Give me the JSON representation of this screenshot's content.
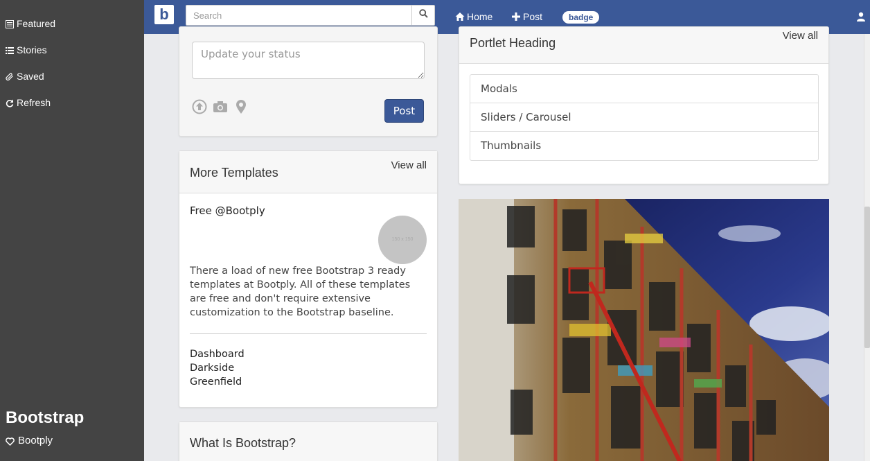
{
  "sidebar": {
    "items": [
      {
        "label": "Featured",
        "icon": "list-alt-icon"
      },
      {
        "label": "Stories",
        "icon": "list-icon"
      },
      {
        "label": "Saved",
        "icon": "paperclip-icon"
      },
      {
        "label": "Refresh",
        "icon": "refresh-icon"
      }
    ],
    "brand_title": "Bootstrap",
    "brand_sub": "Bootply"
  },
  "navbar": {
    "logo": "b",
    "search_placeholder": "Search",
    "home_label": "Home",
    "post_label": "Post",
    "badge_label": "badge",
    "colors": {
      "brand": "#3b5998"
    }
  },
  "status": {
    "placeholder": "Update your status",
    "post_button": "Post"
  },
  "templates": {
    "title": "More Templates",
    "view_all": "View all",
    "free_text": "Free @Bootply",
    "thumb_label": "150 x 150",
    "description": "There a load of new free Bootstrap 3 ready templates at Bootply. All of these templates are free and don't require extensive customization to the Bootstrap baseline.",
    "links": [
      "Dashboard",
      "Darkside",
      "Greenfield"
    ]
  },
  "what": {
    "title": "What Is Bootstrap?"
  },
  "portlet": {
    "title": "Portlet Heading",
    "view_all": "View all",
    "items": [
      "Modals",
      "Sliders / Carousel",
      "Thumbnails"
    ]
  }
}
